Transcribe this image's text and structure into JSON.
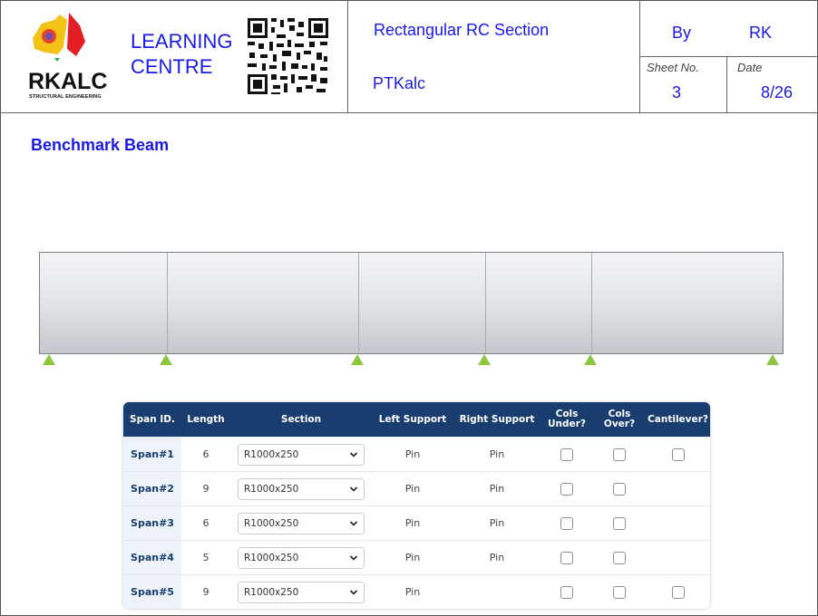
{
  "header": {
    "brand_name": "RKALC",
    "brand_sub": "STRUCTURAL ENGINEERING",
    "centre_line1": "LEARNING",
    "centre_line2": "CENTRE",
    "calc_title": "Rectangular RC Section",
    "software": "PTKalc",
    "by_label": "By",
    "by_value": "RK",
    "sheet_label": "Sheet No.",
    "sheet_value": "3",
    "date_label": "Date",
    "date_value": "8/26"
  },
  "section_title": "Benchmark Beam",
  "beam": {
    "span_lengths": [
      6,
      9,
      6,
      5,
      9
    ],
    "support_color": "#8dc63f"
  },
  "table": {
    "headers": {
      "span_id": "Span ID.",
      "length": "Length",
      "section": "Section",
      "left_support": "Left Support",
      "right_support": "Right Support",
      "cols_under_1": "Cols",
      "cols_under_2": "Under?",
      "cols_over_1": "Cols",
      "cols_over_2": "Over?",
      "cantilever": "Cantilever?"
    },
    "rows": [
      {
        "id": "Span#1",
        "length": "6",
        "section": "R1000x250",
        "left": "Pin",
        "right": "Pin"
      },
      {
        "id": "Span#2",
        "length": "9",
        "section": "R1000x250",
        "left": "Pin",
        "right": "Pin"
      },
      {
        "id": "Span#3",
        "length": "6",
        "section": "R1000x250",
        "left": "Pin",
        "right": "Pin"
      },
      {
        "id": "Span#4",
        "length": "5",
        "section": "R1000x250",
        "left": "Pin",
        "right": "Pin"
      },
      {
        "id": "Span#5",
        "length": "9",
        "section": "R1000x250",
        "left": "Pin",
        "right": ""
      }
    ]
  },
  "colors": {
    "accent_blue": "#1a1ae6",
    "table_header": "#183d6e"
  }
}
